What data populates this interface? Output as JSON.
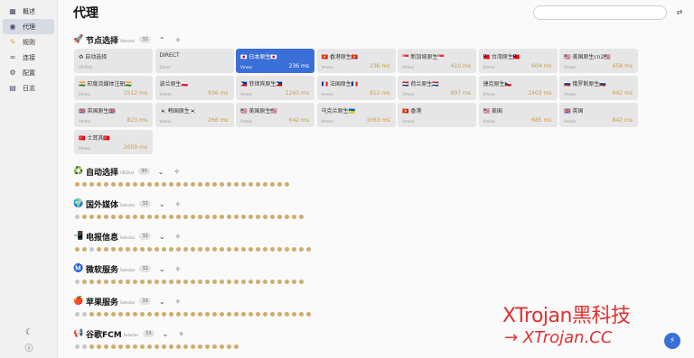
{
  "sidebar": {
    "items": [
      {
        "label": "概述",
        "icon": "dashboard-icon"
      },
      {
        "label": "代理",
        "icon": "globe-icon"
      },
      {
        "label": "规则",
        "icon": "pencil-icon"
      },
      {
        "label": "连接",
        "icon": "link-icon"
      },
      {
        "label": "配置",
        "icon": "gear-icon"
      },
      {
        "label": "日志",
        "icon": "document-icon"
      }
    ],
    "active_index": 1,
    "bottom": {
      "theme_icon": "moon-icon",
      "about_icon": "info-icon"
    }
  },
  "header": {
    "title": "代理",
    "search_placeholder": "",
    "filter_icon": "sliders-icon"
  },
  "node_select": {
    "icon": "🚀",
    "name": "节点选择",
    "type": "Selector",
    "count": "32",
    "nodes": [
      {
        "name": "♻ 自动选择",
        "type": "URLTest",
        "delay": ""
      },
      {
        "name": "DIRECT",
        "type": "Direct",
        "delay": ""
      },
      {
        "name": "🇯🇵 日本原生🇯🇵",
        "type": "Vmess",
        "delay": "236 ms",
        "selected": true
      },
      {
        "name": "🇭🇰 香港原生🇭🇰",
        "type": "Vmess",
        "delay": "236 ms"
      },
      {
        "name": "🇸🇬 新加坡原生🇸🇬",
        "type": "Vmess",
        "delay": "410 ms"
      },
      {
        "name": "🇹🇼 台湾原生🇹🇼",
        "type": "Vmess",
        "delay": "604 ms"
      },
      {
        "name": "🇺🇸 美国原生cn2🇺🇸",
        "type": "Vmess",
        "delay": "658 ms"
      },
      {
        "name": "🇮🇳 印度流媒体注册🇮🇳",
        "type": "Vmess",
        "delay": "1512 ms"
      },
      {
        "name": "波兰原生🇵🇱",
        "type": "Vmess",
        "delay": "936 ms"
      },
      {
        "name": "🇵🇭 菲律宾原生🇵🇭",
        "type": "Vmess",
        "delay": "1263 ms"
      },
      {
        "name": "🇫🇷 法国原生🇫🇷",
        "type": "Vmess",
        "delay": "812 ms"
      },
      {
        "name": "🇳🇱 荷兰原生🇳🇱",
        "type": "Vmess",
        "delay": "897 ms"
      },
      {
        "name": "捷克原生🇨🇿",
        "type": "Vmess",
        "delay": "1403 ms"
      },
      {
        "name": "🇷🇺 俄罗斯原生🇷🇺",
        "type": "Vmess",
        "delay": "692 ms"
      },
      {
        "name": "🇬🇧 英国原生🇬🇧",
        "type": "Vmess",
        "delay": "823 ms"
      },
      {
        "name": "🇰🇷 韩国原生🇰🇷",
        "type": "Vmess",
        "delay": "266 ms"
      },
      {
        "name": "🇺🇸 美国原生🇺🇸",
        "type": "Vmess",
        "delay": "642 ms"
      },
      {
        "name": "乌克兰原生🇺🇦",
        "type": "Vmess",
        "delay": "1063 ms"
      },
      {
        "name": "🇭🇰 香港",
        "type": "Vmess",
        "delay": ""
      },
      {
        "name": "🇺🇸 美国",
        "type": "Vmess",
        "delay": "685 ms"
      },
      {
        "name": "🇬🇧 英国",
        "type": "Vmess",
        "delay": "842 ms"
      },
      {
        "name": "🇹🇷 土耳其🇹🇷",
        "type": "Vmess",
        "delay": "2059 ms"
      }
    ]
  },
  "groups": [
    {
      "icon": "♻️",
      "name": "自动选择",
      "type": "URLTest",
      "count": "30",
      "dots": "gggggggggggggggggggggggggggggg"
    },
    {
      "icon": "🌍",
      "name": "国外媒体",
      "type": "Selector",
      "count": "32",
      "dots": "bggggggggggggggggggggggggggggggg"
    },
    {
      "icon": "📲",
      "name": "电报信息",
      "type": "Selector",
      "count": "32",
      "dots": "ggbgggggggggggggggggggggggggggggg"
    },
    {
      "icon": "Ⓜ️",
      "name": "微软服务",
      "type": "Selector",
      "count": "32",
      "dots": "bggggggggggggggggggggggggggggggg"
    },
    {
      "icon": "🍎",
      "name": "苹果服务",
      "type": "Selector",
      "count": "33",
      "dots": "bbggggggggggggggggggggggggggggggg"
    },
    {
      "icon": "📢",
      "name": "谷歌FCM",
      "type": "Selector",
      "count": "33",
      "dots": "bbggggggggggggggggggggg"
    }
  ],
  "colors": {
    "accent": "#3b6fd8",
    "delay": "#c99a4a",
    "dot_good": "#d1ab6c",
    "dot_idle": "#c5c8ce",
    "watermark": "#e23030"
  },
  "watermark": {
    "line1": "XTrojan黑科技",
    "line2": "→ XTrojan.CC"
  },
  "fab_icon": "lightning-icon"
}
